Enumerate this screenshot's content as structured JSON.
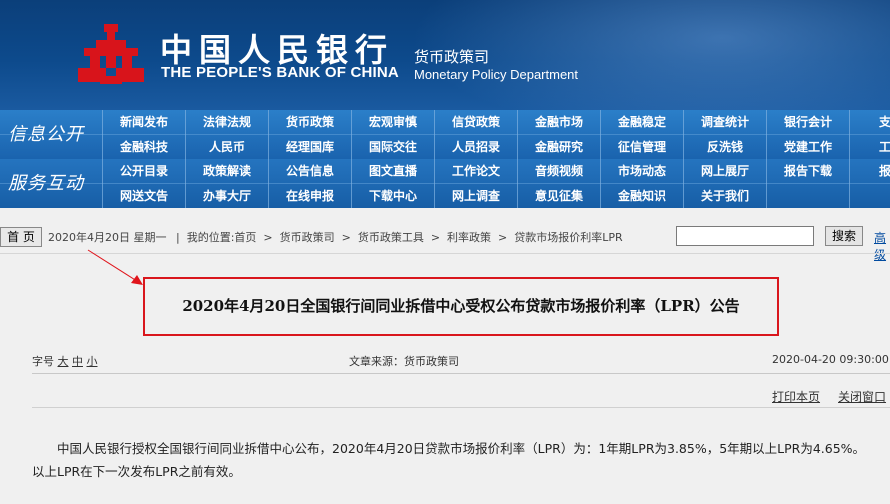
{
  "header": {
    "cn_name": "中国人民银行",
    "en_name": "THE PEOPLE'S BANK OF CHINA",
    "dept_cn": "货币政策司",
    "dept_en": "Monetary Policy Department",
    "logo_color": "#d8141b"
  },
  "nav": {
    "row1_title": "信息公开",
    "row2_title": "服务互动",
    "row1_top": [
      "新闻发布",
      "法律法规",
      "货币政策",
      "宏观审慎",
      "信贷政策",
      "金融市场",
      "金融稳定",
      "调查统计",
      "银行会计",
      "支付"
    ],
    "row1_bottom": [
      "金融科技",
      "人民币",
      "经理国库",
      "国际交往",
      "人员招录",
      "金融研究",
      "征信管理",
      "反洗钱",
      "党建工作",
      "工会"
    ],
    "row2_top": [
      "公开目录",
      "政策解读",
      "公告信息",
      "图文直播",
      "工作论文",
      "音频视频",
      "市场动态",
      "网上展厅",
      "报告下载",
      "报刊"
    ],
    "row2_bottom": [
      "网送文告",
      "办事大厅",
      "在线申报",
      "下载中心",
      "网上调查",
      "意见征集",
      "金融知识",
      "关于我们"
    ]
  },
  "toolbar": {
    "home_label": "首 页",
    "date": "2020年4月20日 星期一",
    "location_prefix": "我的位置:",
    "breadcrumb": [
      "首页",
      "货币政策司",
      "货币政策工具",
      "利率政策",
      "贷款市场报价利率LPR"
    ],
    "search_button": "搜索",
    "advanced": "高级"
  },
  "article": {
    "title": "2020年4月20日全国银行间同业拆借中心受权公布贷款市场报价利率（LPR）公告",
    "font_label": "字号",
    "font_sizes": [
      "大",
      "中",
      "小"
    ],
    "source": "文章来源：货币政策司",
    "datetime": "2020-04-20  09:30:00",
    "print": "打印本页",
    "close": "关闭窗口",
    "body": "中国人民银行授权全国银行间同业拆借中心公布，2020年4月20日贷款市场报价利率（LPR）为：1年期LPR为3.85%，5年期以上LPR为4.65%。以上LPR在下一次发布LPR之前有效。"
  }
}
